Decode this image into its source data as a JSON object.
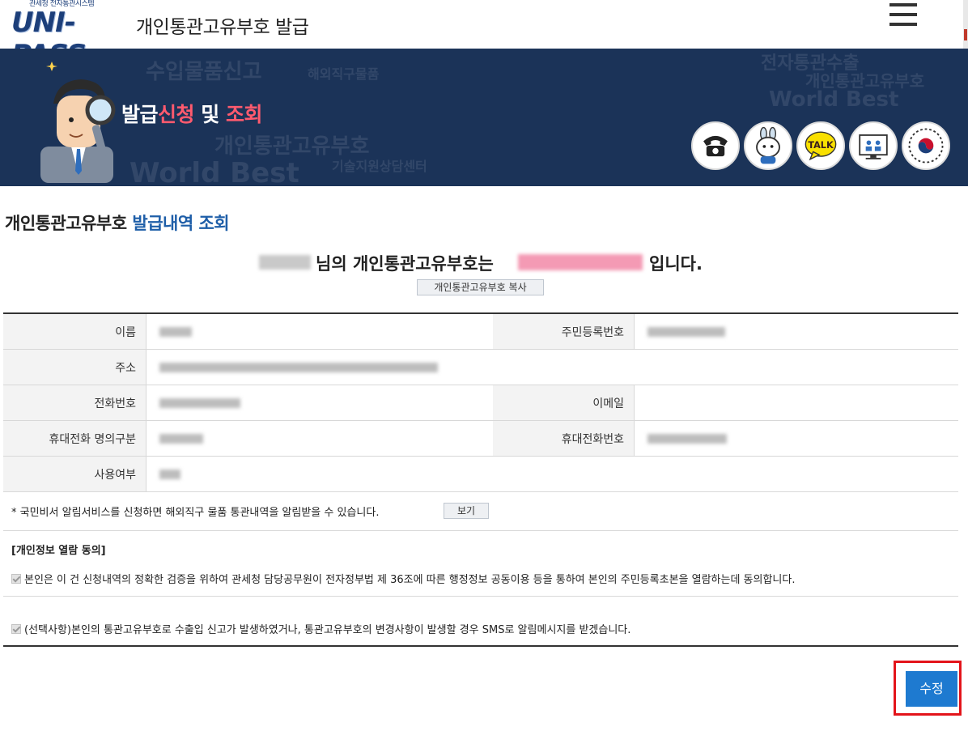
{
  "header": {
    "logo_sub": "관세청 전자통관시스템",
    "logo_main": "UNI-PASS",
    "title": "개인통관고유부호 발급"
  },
  "banner": {
    "title_part1": "발급",
    "title_part2": "신청",
    "title_part3": " 및 ",
    "title_part4": "조회",
    "icons": [
      "phone-icon",
      "chatbot-icon",
      "kakaotalk-icon",
      "remote-support-icon",
      "government-emblem-icon"
    ],
    "talk_label": "TALK"
  },
  "section": {
    "title_black": "개인통관고유부호 ",
    "title_blue": "발급내역 조회"
  },
  "result": {
    "text_middle": "님의 개인통관고유부호는",
    "text_end": "입니다.",
    "copy_button": "개인통관고유부호 복사"
  },
  "table": {
    "name_label": "이름",
    "rrn_label": "주민등록번호",
    "address_label": "주소",
    "phone_label": "전화번호",
    "email_label": "이메일",
    "mobile_owner_label": "휴대전화 명의구분",
    "mobile_label": "휴대전화번호",
    "usage_label": "사용여부"
  },
  "notice": {
    "text": "* 국민비서 알림서비스를 신청하면 해외직구 물품 통관내역을 알림받을 수 있습니다.",
    "button": "보기"
  },
  "consent": {
    "title": "[개인정보 열람 동의]",
    "item1": "본인은 이 건 신청내역의 정확한 검증을 위하여 관세청 담당공무원이 전자정부법 제 36조에 따른 행정정보 공동이용 등을 통하여 본인의 주민등록초본을 열람하는데 동의합니다.",
    "item2": "(선택사항)본인의 통관고유부호로 수출입 신고가 발생하였거나, 통관고유부호의 변경사항이 발생할 경우 SMS로 알림메시지를 받겠습니다."
  },
  "actions": {
    "edit_button": "수정"
  }
}
